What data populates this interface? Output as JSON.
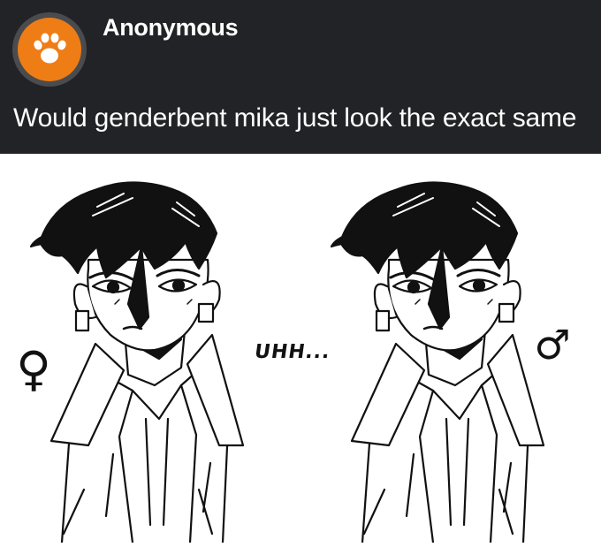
{
  "post": {
    "asker_name": "Anonymous",
    "avatar_icon": "paw-print-icon",
    "question": "Would genderbent mika just look the exact same"
  },
  "comic": {
    "left_symbol": "♀",
    "right_symbol": "♂",
    "speech": "UHH..."
  },
  "colors": {
    "header_bg": "#222326",
    "avatar_orange": "#ee7d16",
    "text": "#ffffff"
  }
}
